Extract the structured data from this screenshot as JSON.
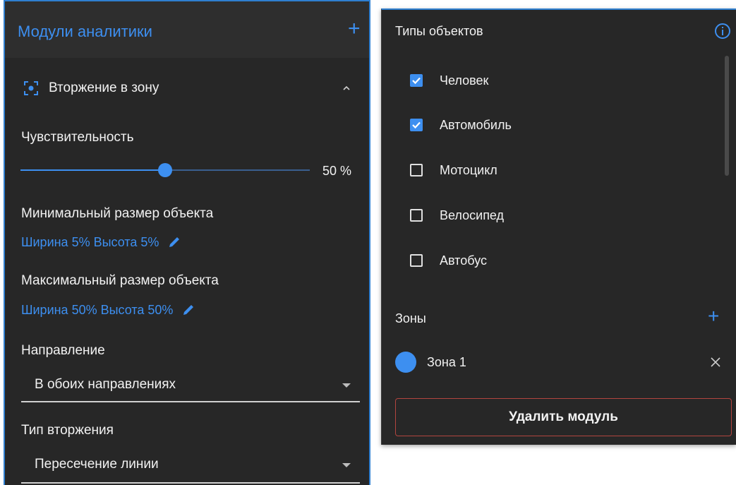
{
  "left_panel": {
    "title": "Модули аналитики",
    "add_label": "+",
    "module_name": "Вторжение в зону",
    "sensitivity_label": "Чувствительность",
    "sensitivity_value_text": "50 %",
    "sensitivity_value": 50,
    "min_size_label": "Минимальный размер объекта",
    "min_size_value": "Ширина 5% Высота 5%",
    "max_size_label": "Максимальный размер объекта",
    "max_size_value": "Ширина 50% Высота 50%",
    "direction_label": "Направление",
    "direction_value": "В обоих направлениях",
    "intrusion_type_label": "Тип вторжения",
    "intrusion_type_value": "Пересечение линии"
  },
  "right_panel": {
    "object_types_label": "Типы объектов",
    "object_types": [
      {
        "label": "Человек",
        "checked": true
      },
      {
        "label": "Автомобиль",
        "checked": true
      },
      {
        "label": "Мотоцикл",
        "checked": false
      },
      {
        "label": "Велосипед",
        "checked": false
      },
      {
        "label": "Автобус",
        "checked": false
      }
    ],
    "zones_label": "Зоны",
    "zones_add_label": "+",
    "zones": [
      {
        "label": "Зона 1",
        "color": "#3d8ff0"
      }
    ],
    "delete_label": "Удалить модуль"
  },
  "colors": {
    "accent": "#3d8ff0",
    "panel": "#272727",
    "danger_border": "#b2453f"
  }
}
